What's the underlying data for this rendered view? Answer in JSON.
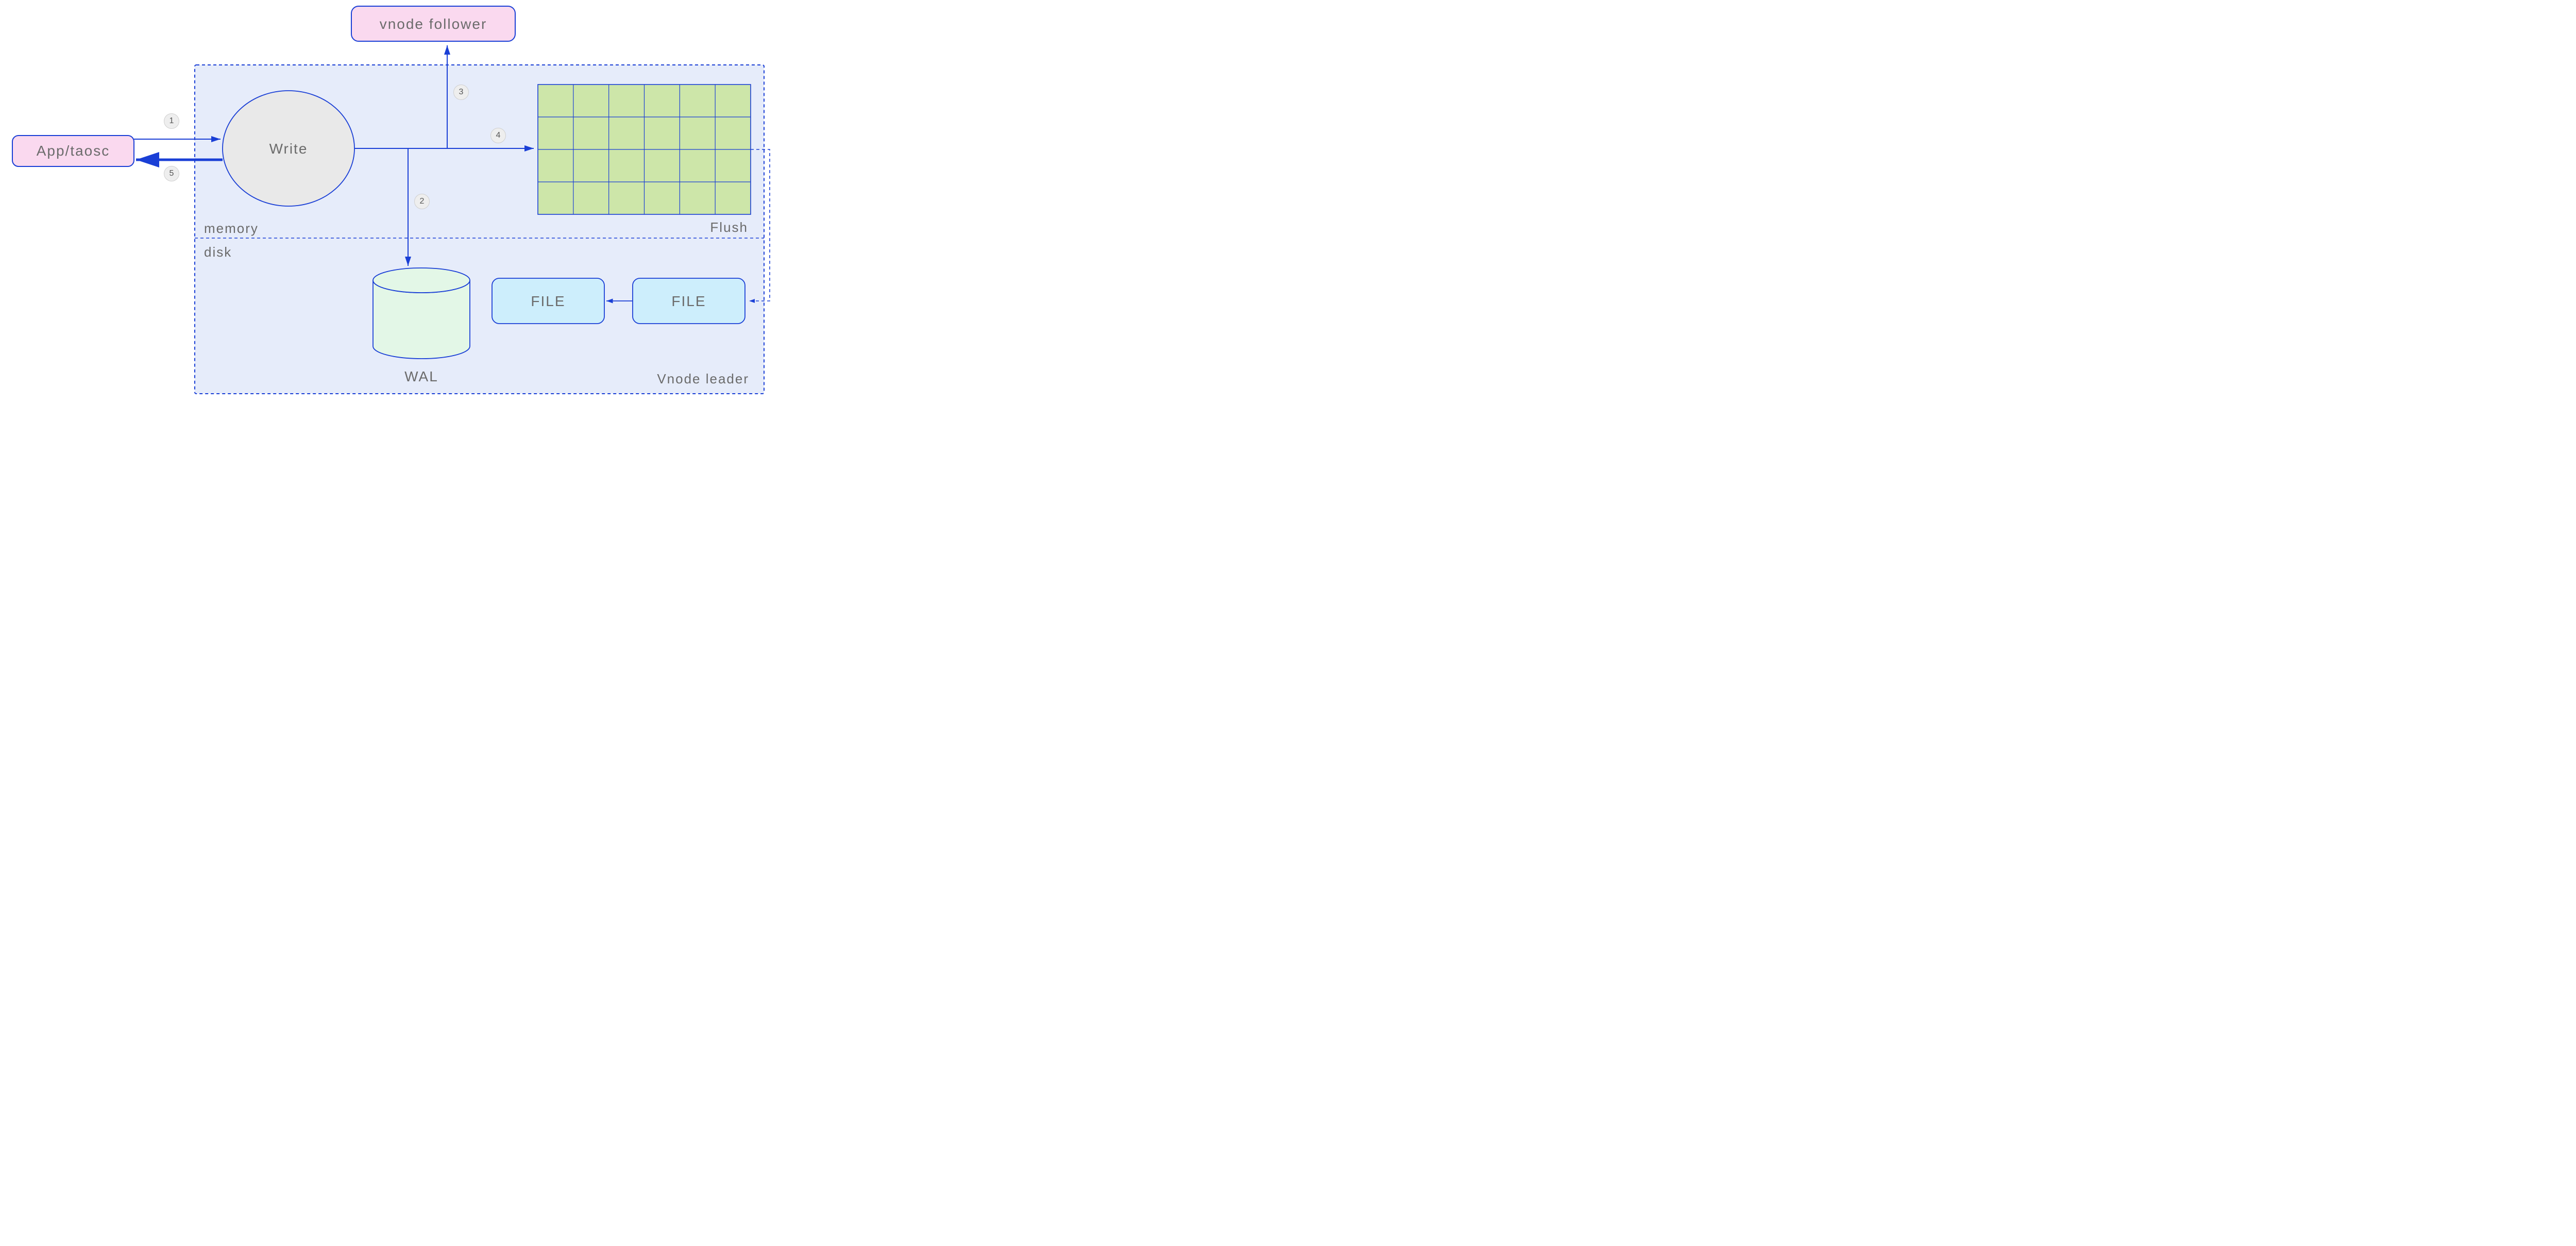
{
  "nodes": {
    "app": "App/taosc",
    "follower": "vnode follower",
    "write": "Write",
    "wal": "WAL",
    "file1": "FILE",
    "file2": "FILE"
  },
  "regions": {
    "memory": "memory",
    "disk": "disk",
    "flush": "Flush",
    "leader": "Vnode leader"
  },
  "steps": {
    "s1": "1",
    "s2": "2",
    "s3": "3",
    "s4": "4",
    "s5": "5"
  },
  "colors": {
    "blue": "#1a3fd6",
    "lightBlueFill": "#e6ecfa",
    "pinkFill": "#fad9ef",
    "pinkStroke": "#1a3fd6",
    "greyFill": "#e9e9e9",
    "greenFill": "#dff2d1",
    "greenCyl": "#e3f7e7",
    "cyanFill": "#cdeefc",
    "gridFill": "#cde6a9"
  },
  "grid": {
    "rows": 4,
    "cols": 6
  }
}
